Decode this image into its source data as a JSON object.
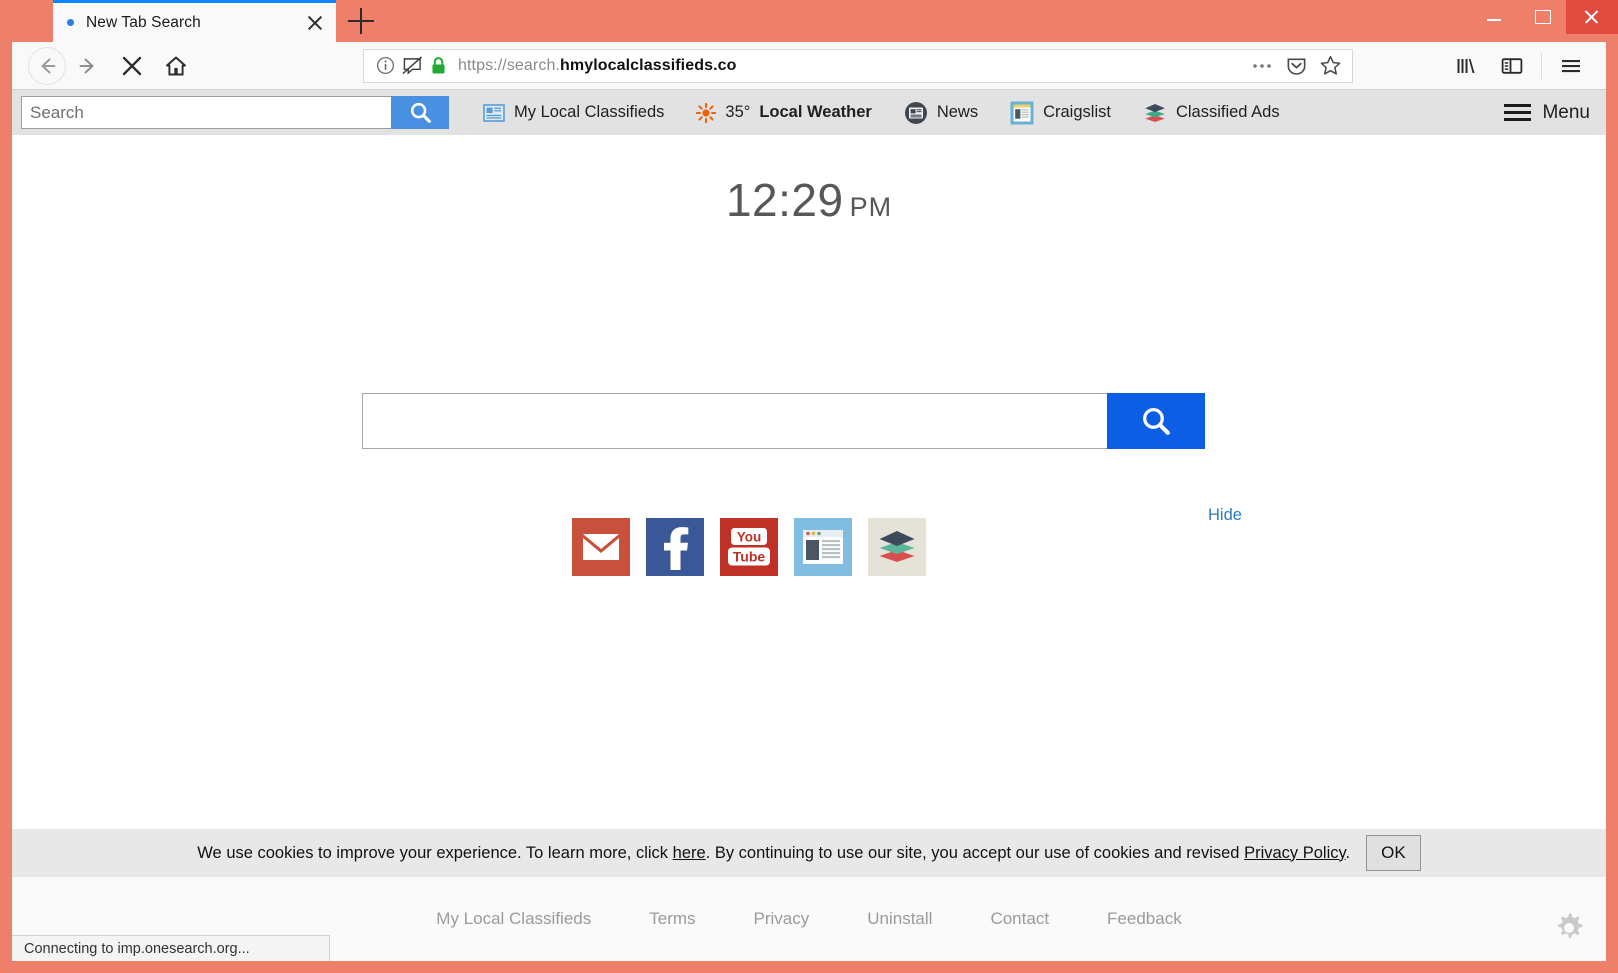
{
  "browser": {
    "tab": {
      "title": "New Tab Search",
      "close_label": "×"
    },
    "new_tab_label": "+",
    "window_controls": {
      "minimize": "–",
      "maximize": "❐",
      "close": "✕"
    },
    "nav": {
      "back": "back-arrow",
      "forward": "forward-arrow",
      "stop": "stop-x",
      "home": "home"
    },
    "url": {
      "protocol_prefix": "https://search.",
      "domain_bold": "hmylocalclassifieds.co",
      "full": "https://search.hmylocalclassifieds.co",
      "identity_icons": [
        "info-icon",
        "tracking-protection-icon",
        "lock-icon"
      ],
      "lock_color": "#22aa33",
      "action_icons": [
        "page-actions-icon",
        "pocket-icon",
        "bookmark-star-icon"
      ]
    },
    "toolbar_right_icons": [
      "library-icon",
      "sidebar-icon",
      "hamburger-menu-icon"
    ],
    "status_text": "Connecting to imp.onesearch.org..."
  },
  "extension_toolbar": {
    "search_placeholder": "Search",
    "search_value": "",
    "search_button": "search-icon",
    "accent": "#4a90e2",
    "links": [
      {
        "label": "My Local Classifieds",
        "icon": "newspaper-icon",
        "bold": false
      },
      {
        "label": "Local Weather",
        "icon": "sun-icon",
        "prefix": "35°",
        "bold": true
      },
      {
        "label": "News",
        "icon": "news-circle-icon",
        "bold": false
      },
      {
        "label": "Craigslist",
        "icon": "craigslist-icon",
        "bold": false
      },
      {
        "label": "Classified Ads",
        "icon": "layers-icon",
        "bold": false
      }
    ],
    "menu_label": "Menu"
  },
  "page": {
    "clock": {
      "time": "12:29",
      "ampm": "PM"
    },
    "search": {
      "value": "",
      "placeholder": "",
      "button_icon": "search-icon",
      "button_color": "#0c5fe4"
    },
    "hide_label": "Hide",
    "shortcuts": [
      {
        "name": "mail",
        "label": "Mail",
        "color": "#c8503c"
      },
      {
        "name": "facebook",
        "label": "Facebook",
        "color": "#3a5897"
      },
      {
        "name": "youtube",
        "label": "YouTube",
        "color": "#bf3126"
      },
      {
        "name": "news",
        "label": "News",
        "color": "#81bde0"
      },
      {
        "name": "classified-ads",
        "label": "Classified Ads",
        "color": "#e5e3d8"
      }
    ],
    "cookie": {
      "text_before_here": "We use cookies to improve your experience. To learn more, click ",
      "here_label": "here",
      "text_middle": ". By continuing to use our site, you accept our use of cookies and revised ",
      "privacy_label": "Privacy Policy",
      "text_after": ".",
      "ok_label": "OK"
    },
    "footer_links": [
      "My Local Classifieds",
      "Terms",
      "Privacy",
      "Uninstall",
      "Contact",
      "Feedback"
    ],
    "gear_icon": "settings-gear-icon"
  },
  "theme": {
    "window_chrome": "#ed7f6b",
    "tab_active_bg": "#f9f9f9",
    "tab_accent": "#0a84ff",
    "ext_toolbar_bg": "#e2e2e2",
    "cookie_bg": "#e8e8e8",
    "footer_bg": "#fafafa"
  }
}
